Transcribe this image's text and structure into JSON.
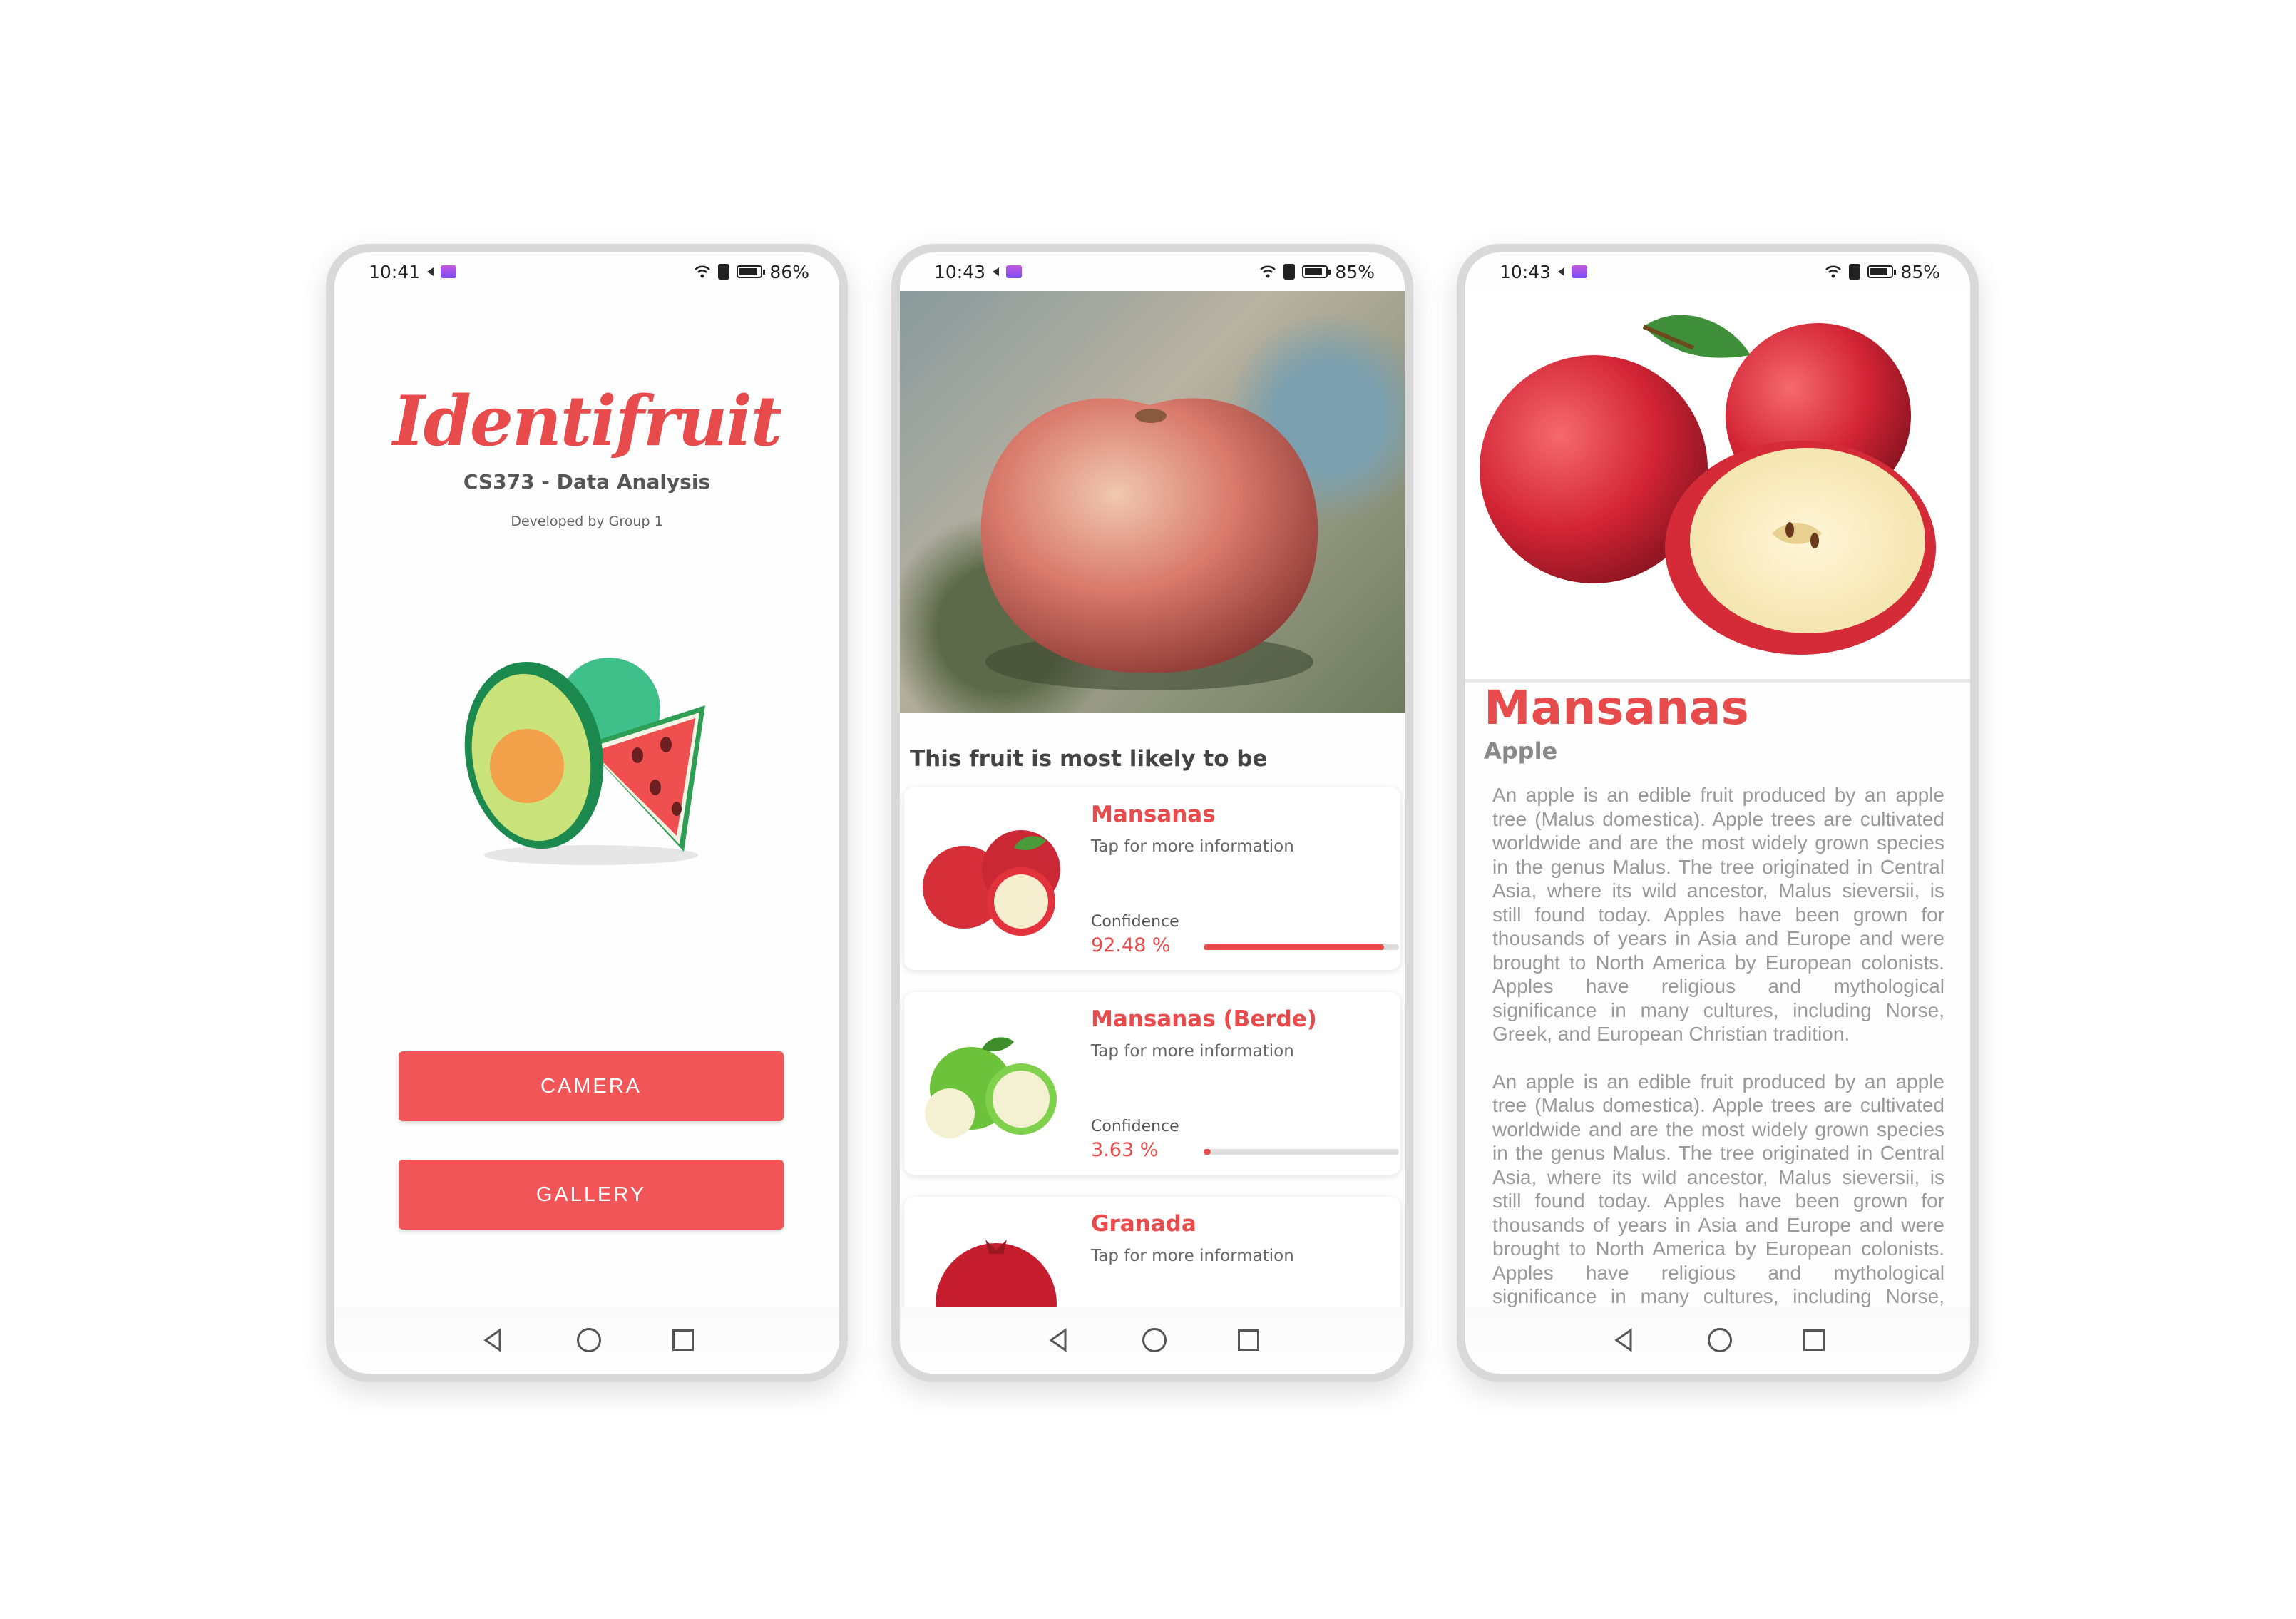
{
  "phones": [
    {
      "status": {
        "time": "10:41",
        "battery": "86%",
        "battery_level": 0.86
      },
      "app_title": "Identifruit",
      "subtitle": "CS373 - Data Analysis",
      "developer": "Developed by Group 1",
      "buttons": {
        "camera": "CAMERA",
        "gallery": "GALLERY"
      }
    },
    {
      "status": {
        "time": "10:43",
        "battery": "85%",
        "battery_level": 0.85
      },
      "heading": "This fruit is most likely to be",
      "results": [
        {
          "name": "Mansanas",
          "tap": "Tap for more information",
          "confidence_label": "Confidence",
          "confidence": "92.48 %",
          "confidence_fraction": 0.9248
        },
        {
          "name": "Mansanas (Berde)",
          "tap": "Tap for more information",
          "confidence_label": "Confidence",
          "confidence": "3.63 %",
          "confidence_fraction": 0.0363
        },
        {
          "name": "Granada",
          "tap": "Tap for more information"
        }
      ]
    },
    {
      "status": {
        "time": "10:43",
        "battery": "85%",
        "battery_level": 0.85
      },
      "name": "Mansanas",
      "english_name": "Apple",
      "paragraphs": [
        "An apple is an edible fruit produced by an apple tree (Malus domestica). Apple trees are cultivated worldwide and are the most widely grown species in the genus Malus. The tree originated in Central Asia, where its wild ancestor, Malus sieversii, is still found today. Apples have been grown for thousands of years in Asia and Europe and were brought to North America by European colonists. Apples have religious and mythological significance in many cultures, including Norse, Greek, and European Christian tradition.",
        "An apple is an edible fruit produced by an apple tree (Malus domestica). Apple trees are cultivated worldwide and are the most widely grown species in the genus Malus. The tree originated in Central Asia, where its wild ancestor, Malus sieversii, is still found today. Apples have been grown for thousands of years in Asia and Europe and were brought to North America by European colonists. Apples have religious and mythological significance in many cultures, including Norse, Greek, and European Christian tradition."
      ]
    }
  ],
  "colors": {
    "accent": "#e84b4b",
    "button": "#f25557"
  },
  "icons": [
    "volume-icon",
    "gallery-notification-icon",
    "wifi-icon",
    "sim-icon",
    "battery-icon",
    "back-icon",
    "home-icon",
    "recents-icon"
  ]
}
